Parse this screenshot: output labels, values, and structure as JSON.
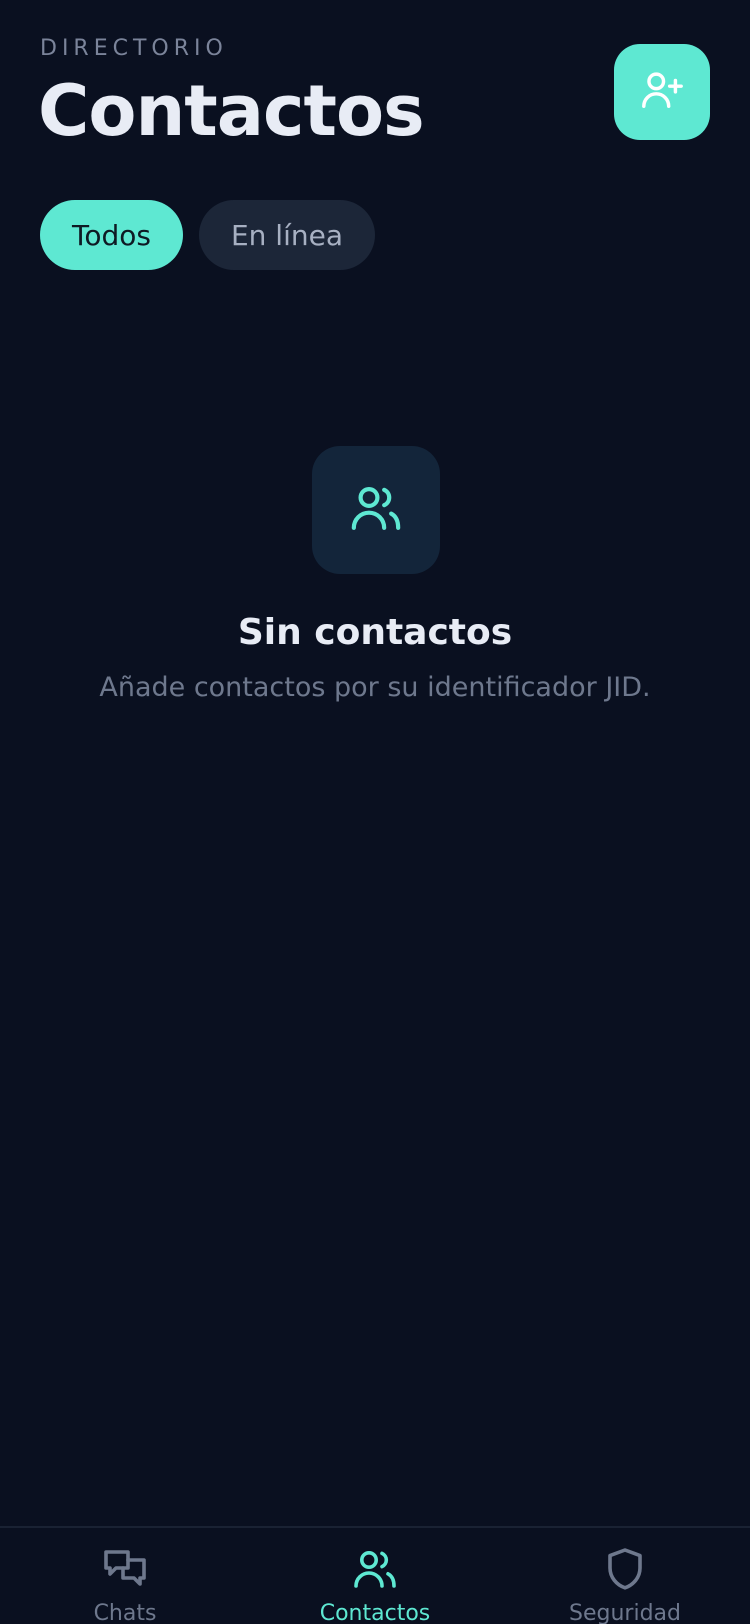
{
  "header": {
    "eyebrow": "DIRECTORIO",
    "title": "Contactos",
    "add_button_icon": "user-plus-icon"
  },
  "filters": [
    {
      "label": "Todos",
      "active": true
    },
    {
      "label": "En línea",
      "active": false
    }
  ],
  "empty_state": {
    "icon": "users-icon",
    "title": "Sin contactos",
    "subtitle": "Añade contactos por su identificador JID."
  },
  "bottom_nav": {
    "items": [
      {
        "label": "Chats",
        "icon": "chat-bubbles-icon",
        "active": false
      },
      {
        "label": "Contactos",
        "icon": "users-icon",
        "active": true
      },
      {
        "label": "Seguridad",
        "icon": "shield-icon",
        "active": false
      }
    ]
  },
  "colors": {
    "background": "#0a1020",
    "accent": "#5ee8d2",
    "text_primary": "#e8ecf5",
    "text_muted": "#6e788d",
    "chip_inactive_bg": "#1c2638"
  }
}
